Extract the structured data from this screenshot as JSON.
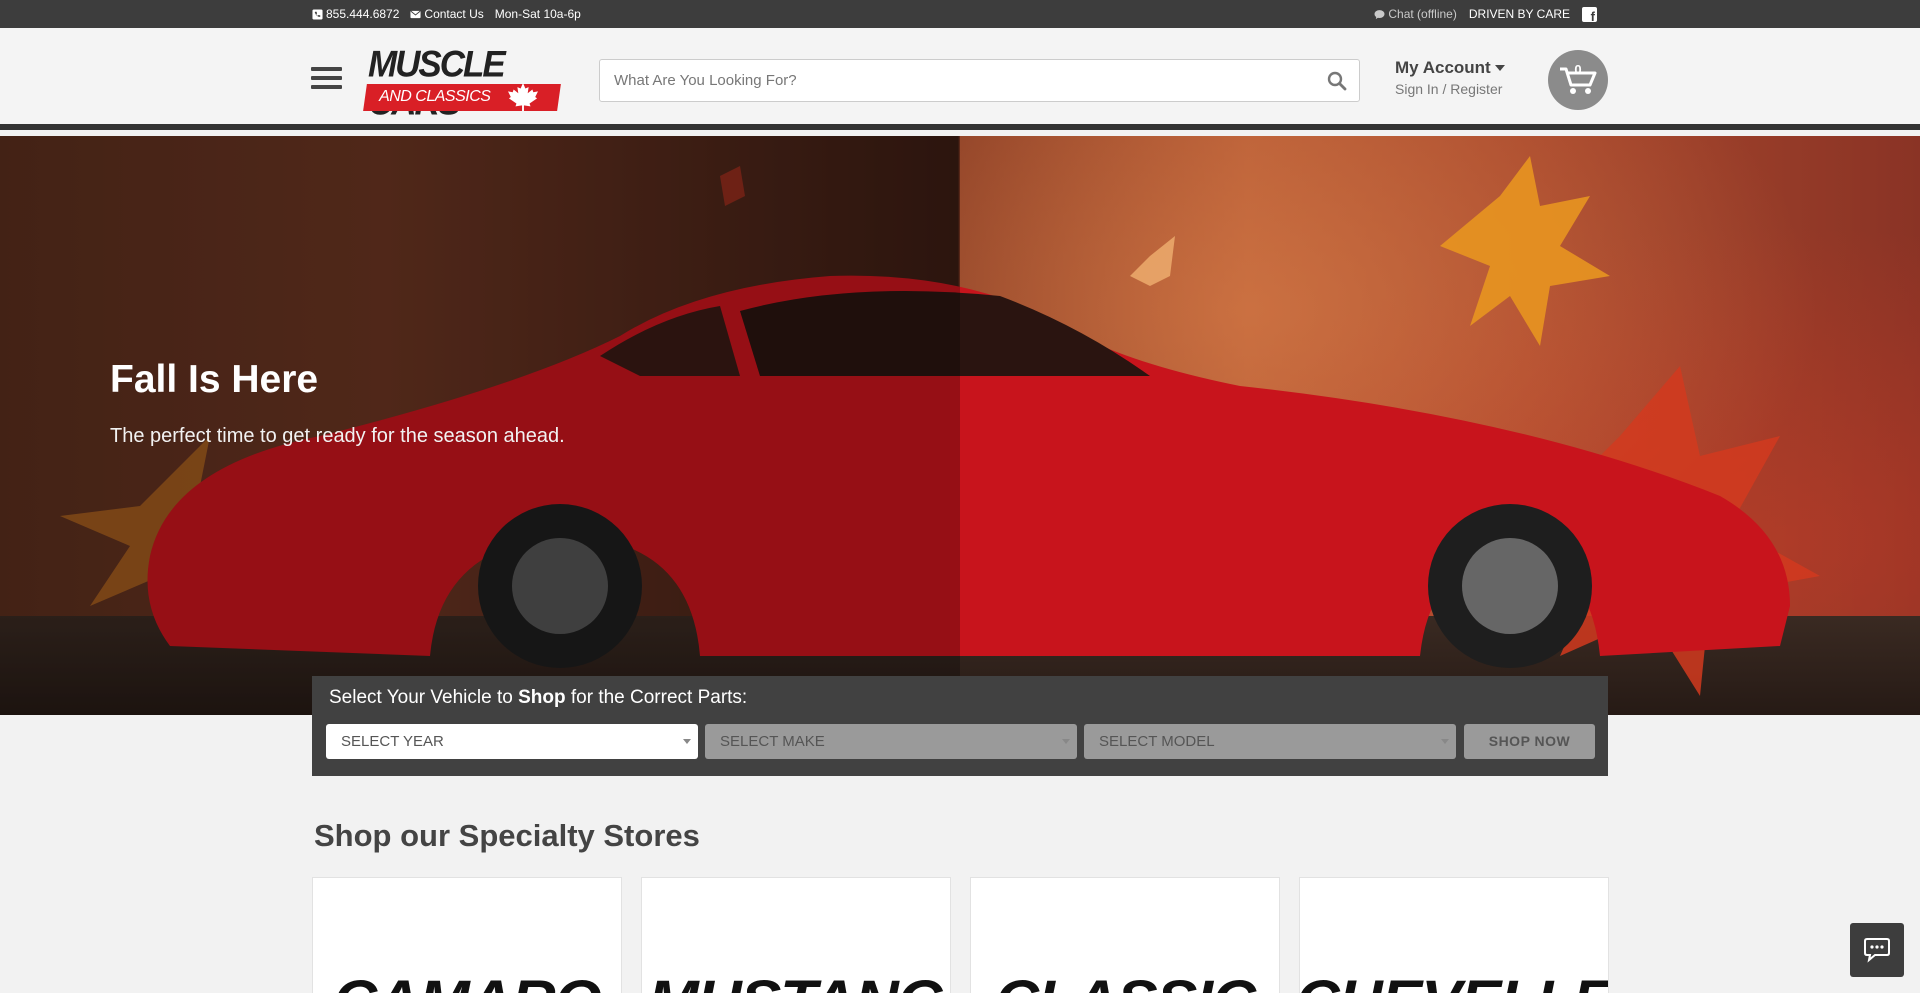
{
  "topbar": {
    "phone": "855.444.6872",
    "contact": "Contact Us",
    "hours": "Mon-Sat 10a-6p",
    "chat": "Chat (offline)",
    "slogan": "DRIVEN BY CARE",
    "facebook_glyph": "f"
  },
  "header": {
    "logo_top": "MUSCLE CARS",
    "logo_bottom": "AND CLASSICS",
    "search_placeholder": "What Are You Looking For?",
    "account_title": "My Account",
    "account_links": "Sign In / Register",
    "cart_count": "0"
  },
  "hero": {
    "title": "Fall Is Here",
    "subtitle": "The perfect time to get ready for the season ahead."
  },
  "vehicle_selector": {
    "title_pre": "Select Your Vehicle to ",
    "title_bold": "Shop",
    "title_post": " for the Correct Parts:",
    "year": "SELECT YEAR",
    "make": "SELECT MAKE",
    "model": "SELECT MODEL",
    "shop_button": "SHOP NOW"
  },
  "stores": {
    "title": "Shop our Specialty Stores",
    "cards": [
      "CAMARO",
      "MUSTANG",
      "CLASSIC",
      "CHEVELLE"
    ]
  },
  "colors": {
    "topbar": "#3d3d3d",
    "brand_red": "#d91f26",
    "selector_bg": "#414141"
  },
  "icons": [
    "phone-icon",
    "mail-icon",
    "chat-icon",
    "facebook-icon",
    "hamburger-icon",
    "maple-leaf-icon",
    "search-icon",
    "caret-down-icon",
    "cart-icon",
    "chat-bubble-icon"
  ]
}
